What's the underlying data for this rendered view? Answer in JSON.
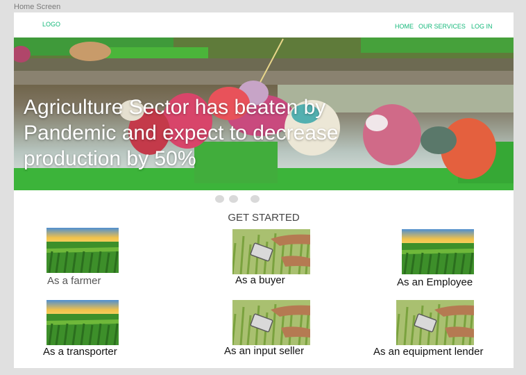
{
  "frame": {
    "label": "Home Screen"
  },
  "header": {
    "logo": "LOGO",
    "nav": {
      "home": "HOME",
      "services": "OUR SERVICES",
      "login": "LOG IN"
    }
  },
  "hero": {
    "title": "Agriculture Sector has beaten by Pandemic and expect to decrease production by 50%"
  },
  "carousel": {
    "slides": 3
  },
  "get_started": {
    "heading": "GET STARTED",
    "options": [
      {
        "label": "As a farmer",
        "image": "crop-field-sunset"
      },
      {
        "label": "As a buyer",
        "image": "tablet-in-field"
      },
      {
        "label": "As an Employee",
        "image": "crop-field-sunset"
      },
      {
        "label": "As a transporter",
        "image": "crop-field-sunset"
      },
      {
        "label": "As an input seller",
        "image": "tablet-in-field"
      },
      {
        "label": "As an equipment lender",
        "image": "tablet-in-field"
      }
    ]
  },
  "colors": {
    "accent": "#14b87a",
    "page_bg": "#e0e0e0"
  }
}
